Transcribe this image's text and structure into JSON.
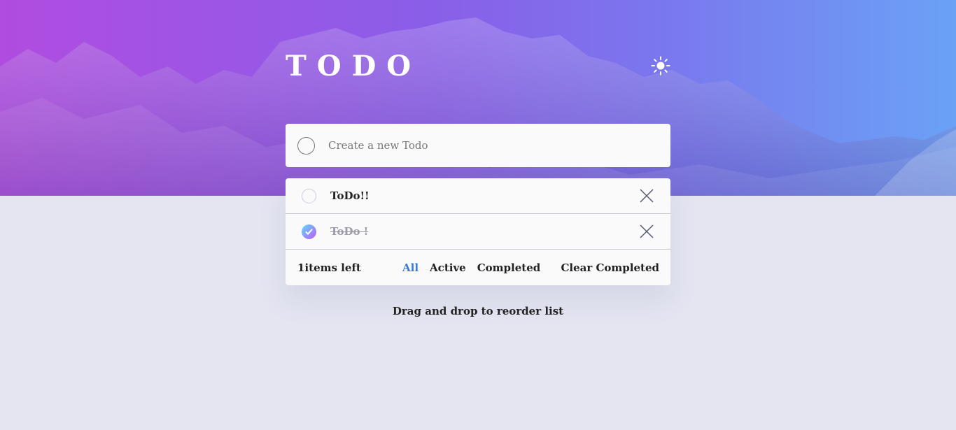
{
  "app": {
    "title": "TODO"
  },
  "colors": {
    "accent": "#3a7bd5",
    "gradient_start": "#57ddff",
    "gradient_end": "#c058f3"
  },
  "icons": {
    "theme": "sun-icon",
    "check": "check-icon",
    "delete": "cross-icon"
  },
  "new_todo": {
    "placeholder": "Create a new Todo",
    "value": ""
  },
  "todos": [
    {
      "text": "ToDo!!",
      "completed": false
    },
    {
      "text": "ToDo !",
      "completed": true
    }
  ],
  "footer": {
    "items_left": "1items left",
    "filters": [
      "All",
      "Active",
      "Completed"
    ],
    "active_filter": "All",
    "clear_label": "Clear Completed"
  },
  "hint": "Drag and drop to reorder list"
}
